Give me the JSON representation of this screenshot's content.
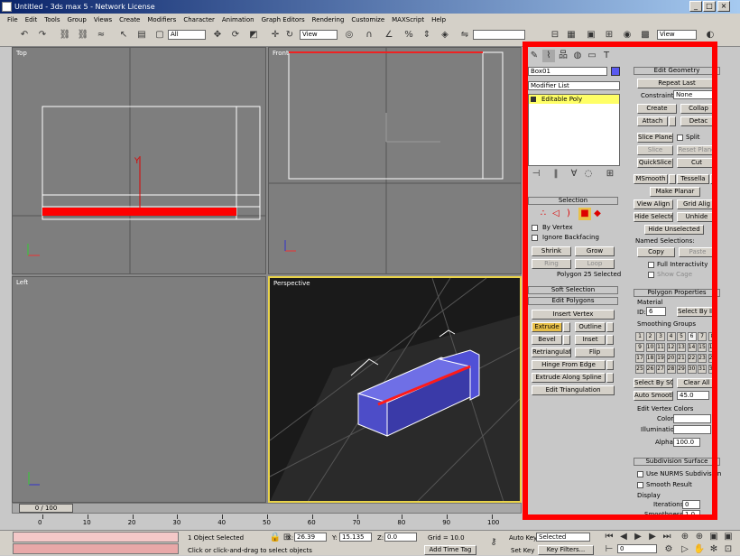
{
  "window": {
    "title": "Untitled - 3ds max 5 - Network License",
    "min": "_",
    "max": "□",
    "close": "×"
  },
  "menu": [
    "File",
    "Edit",
    "Tools",
    "Group",
    "Views",
    "Create",
    "Modifiers",
    "Character",
    "Animation",
    "Graph Editors",
    "Rendering",
    "Customize",
    "MAXScript",
    "Help"
  ],
  "toolbar": {
    "filter": "All",
    "coord": "View",
    "coord2": "View"
  },
  "viewports": {
    "top": "Top",
    "front": "Front",
    "left": "Left",
    "persp": "Perspective"
  },
  "command": {
    "object_name": "Box01",
    "modifier_list": "Modifier List",
    "stack_item": "Editable Poly",
    "selection_title": "Selection",
    "by_vertex": "By Vertex",
    "ignore_backfacing": "Ignore Backfacing",
    "shrink": "Shrink",
    "grow": "Grow",
    "ring": "Ring",
    "loop": "Loop",
    "poly_selected": "Polygon 25 Selected",
    "soft_selection": "Soft Selection",
    "edit_polygons": "Edit Polygons",
    "insert_vertex": "Insert Vertex",
    "extrude": "Extrude",
    "outline": "Outline",
    "bevel": "Bevel",
    "inset": "Inset",
    "retriangulate": "Retriangulate",
    "flip": "Flip",
    "hinge": "Hinge From Edge",
    "extrude_spline": "Extrude Along Spline",
    "edit_tri": "Edit Triangulation"
  },
  "geometry": {
    "title": "Edit Geometry",
    "repeat_last": "Repeat Last",
    "constraints_label": "Constraints:",
    "constraints_value": "None",
    "create": "Create",
    "collapse": "Collap",
    "attach": "Attach",
    "detach": "Detac",
    "slice_plane": "Slice Plane",
    "split": "Split",
    "slice": "Slice",
    "reset_plane": "Reset Plane",
    "quickslice": "QuickSlice",
    "cut": "Cut",
    "msmooth": "MSmooth",
    "tessellate": "Tessella",
    "make_planar": "Make Planar",
    "view_align": "View Align",
    "grid_align": "Grid Alig",
    "hide_selected": "Hide Selected",
    "unhide": "Unhide",
    "hide_unselected": "Hide Unselected",
    "named_sel": "Named Selections:",
    "copy": "Copy",
    "paste": "Paste",
    "full_interactivity": "Full Interactivity",
    "show_cage": "Show Cage"
  },
  "polyprops": {
    "title": "Polygon Properties",
    "material": "Material",
    "id_label": "ID:",
    "id_value": "6",
    "select_by_id": "Select By ID",
    "smoothing_groups": "Smoothing Groups",
    "sg": [
      "1",
      "2",
      "3",
      "4",
      "5",
      "6",
      "7",
      "8",
      "9",
      "10",
      "11",
      "12",
      "13",
      "14",
      "15",
      "16",
      "17",
      "18",
      "19",
      "20",
      "21",
      "22",
      "23",
      "24",
      "25",
      "26",
      "27",
      "28",
      "29",
      "30",
      "31",
      "32"
    ],
    "select_by_sg": "Select By SG",
    "clear_all": "Clear All",
    "auto_smooth": "Auto Smooth",
    "auto_smooth_value": "45.0",
    "vertex_colors": "Edit Vertex Colors",
    "color": "Color:",
    "illumination": "Illumination:",
    "alpha": "Alpha:",
    "alpha_value": "100.0"
  },
  "subdiv": {
    "title": "Subdivision Surface",
    "use_nurms": "Use NURMS Subdivision",
    "smooth_result": "Smooth Result",
    "display": "Display",
    "iterations": "Iterations:",
    "iterations_value": "0",
    "smoothness": "Smoothness:",
    "smoothness_value": "1.0"
  },
  "timeline": {
    "frame": "0 / 100",
    "ticks": [
      "0",
      "10",
      "20",
      "30",
      "40",
      "50",
      "60",
      "70",
      "80",
      "90",
      "100"
    ]
  },
  "status": {
    "objects": "1 Object Selected",
    "prompt": "Click or click-and-drag to select objects",
    "x_label": "X:",
    "x": "26.39",
    "y_label": "Y:",
    "y": "15.135",
    "z_label": "Z:",
    "z": "0.0",
    "grid": "Grid = 10.0",
    "add_time_tag": "Add Time Tag",
    "auto_key": "Auto Key",
    "set_key": "Set Key",
    "selected": "Selected",
    "key_filters": "Key Filters...",
    "frame_value": "0"
  }
}
